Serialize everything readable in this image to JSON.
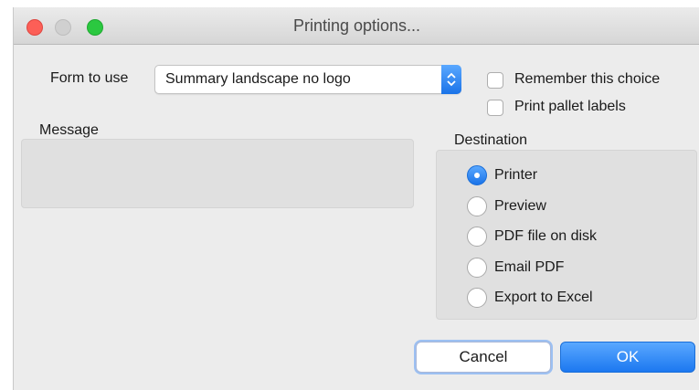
{
  "window": {
    "title": "Printing options..."
  },
  "form": {
    "label": "Form to use",
    "selected": "Summary landscape no logo"
  },
  "options": {
    "remember_label": "Remember this choice",
    "remember_checked": false,
    "pallet_label": "Print pallet labels",
    "pallet_checked": false
  },
  "message": {
    "label": "Message",
    "value": ""
  },
  "destination": {
    "label": "Destination",
    "selected": "Printer",
    "options": [
      {
        "label": "Printer"
      },
      {
        "label": "Preview"
      },
      {
        "label": "PDF file on disk"
      },
      {
        "label": "Email PDF"
      },
      {
        "label": "Export to Excel"
      }
    ]
  },
  "buttons": {
    "cancel": "Cancel",
    "ok": "OK"
  },
  "colors": {
    "accent": "#1a73e8",
    "close": "#fc5f57",
    "maximize": "#2bc840"
  }
}
